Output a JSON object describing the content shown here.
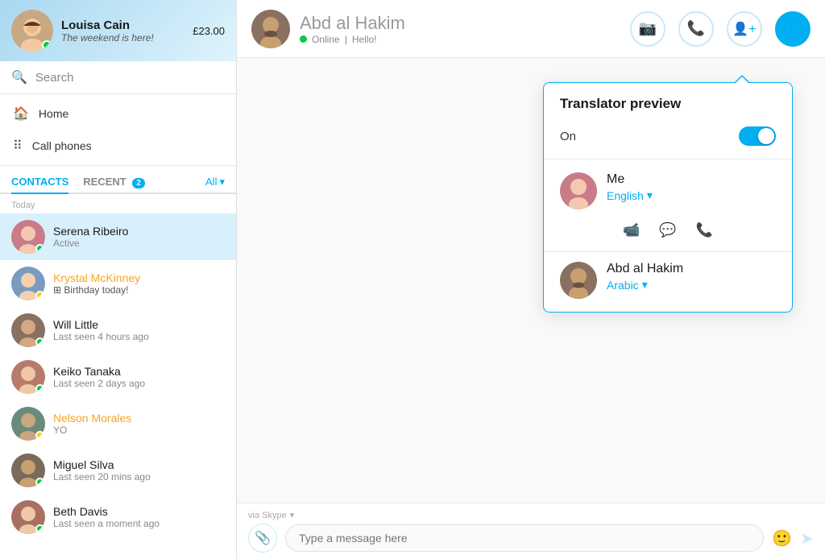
{
  "sidebar": {
    "profile": {
      "name": "Louisa Cain",
      "status": "The weekend is here!",
      "credit": "£23.00",
      "online": true
    },
    "search_placeholder": "Search",
    "nav": [
      {
        "id": "home",
        "label": "Home",
        "icon": "🏠"
      },
      {
        "id": "call-phones",
        "label": "Call phones",
        "icon": "⠿"
      }
    ],
    "tabs": [
      {
        "id": "contacts",
        "label": "CONTACTS",
        "active": true,
        "badge": null
      },
      {
        "id": "recent",
        "label": "RECENT",
        "active": false,
        "badge": "2"
      }
    ],
    "tab_all": "All",
    "section_today": "Today",
    "contacts": [
      {
        "id": "serena",
        "name": "Serena Ribeiro",
        "sub": "Active",
        "status": "online",
        "active": true,
        "name_color": "normal"
      },
      {
        "id": "krystal",
        "name": "Krystal McKinney",
        "sub": "Birthday today!",
        "status": "away",
        "active": false,
        "name_color": "orange",
        "birthday": true
      },
      {
        "id": "will",
        "name": "Will Little",
        "sub": "Last seen 4 hours ago",
        "status": "online",
        "active": false,
        "name_color": "normal"
      },
      {
        "id": "keiko",
        "name": "Keiko Tanaka",
        "sub": "Last seen 2 days ago",
        "status": "online",
        "active": false,
        "name_color": "normal"
      },
      {
        "id": "nelson",
        "name": "Nelson Morales",
        "sub": "YO",
        "status": "away",
        "active": false,
        "name_color": "orange"
      },
      {
        "id": "miguel",
        "name": "Miguel Silva",
        "sub": "Last seen 20 mins ago",
        "status": "online",
        "active": false,
        "name_color": "normal"
      },
      {
        "id": "beth",
        "name": "Beth Davis",
        "sub": "Last seen a moment ago",
        "status": "online",
        "active": false,
        "name_color": "normal"
      }
    ]
  },
  "topbar": {
    "contact_name": "Abd al Hakim",
    "contact_status": "Online",
    "contact_status_detail": "Hello!",
    "actions": [
      "video",
      "call",
      "add-contact",
      "translator"
    ]
  },
  "translator": {
    "title": "Translator preview",
    "toggle_label": "On",
    "toggle_on": true,
    "me": {
      "name": "Me",
      "language": "English"
    },
    "other": {
      "name": "Abd al Hakim",
      "language": "Arabic"
    }
  },
  "input": {
    "via_label": "via Skype",
    "placeholder": "Type a message here"
  }
}
